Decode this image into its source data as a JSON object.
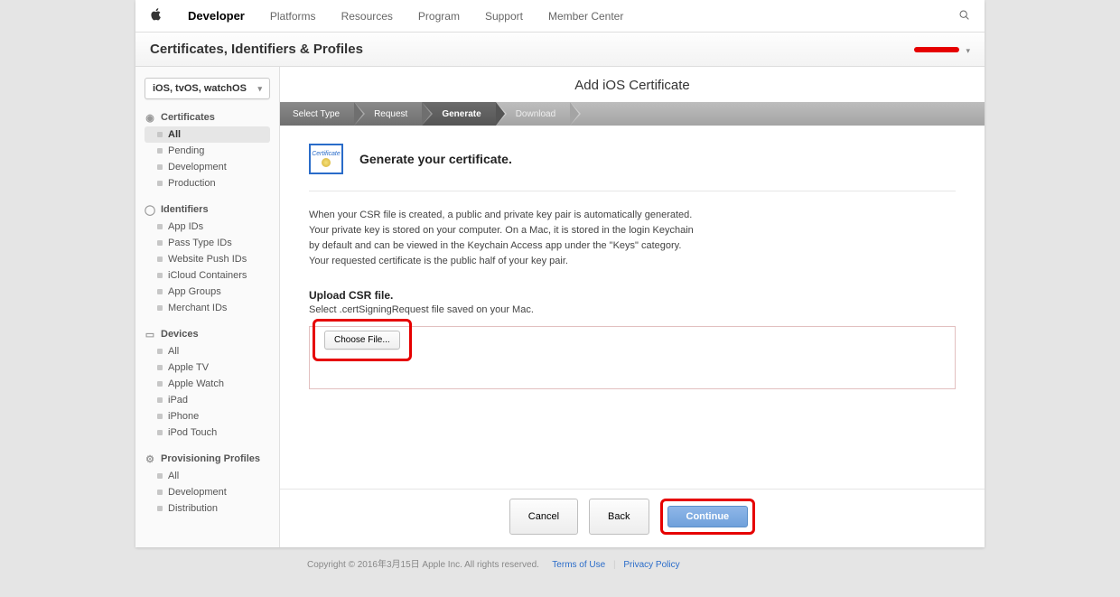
{
  "topnav": {
    "brand": "Developer",
    "links": [
      "Platforms",
      "Resources",
      "Program",
      "Support",
      "Member Center"
    ]
  },
  "subheader": {
    "title": "Certificates, Identifiers & Profiles"
  },
  "sidebar": {
    "platform_selector": "iOS, tvOS, watchOS",
    "groups": [
      {
        "label": "Certificates",
        "items": [
          "All",
          "Pending",
          "Development",
          "Production"
        ],
        "selected": 0
      },
      {
        "label": "Identifiers",
        "items": [
          "App IDs",
          "Pass Type IDs",
          "Website Push IDs",
          "iCloud Containers",
          "App Groups",
          "Merchant IDs"
        ],
        "selected": -1
      },
      {
        "label": "Devices",
        "items": [
          "All",
          "Apple TV",
          "Apple Watch",
          "iPad",
          "iPhone",
          "iPod Touch"
        ],
        "selected": -1
      },
      {
        "label": "Provisioning Profiles",
        "items": [
          "All",
          "Development",
          "Distribution"
        ],
        "selected": -1
      }
    ]
  },
  "main": {
    "page_title": "Add iOS Certificate",
    "wizard": {
      "steps": [
        "Select Type",
        "Request",
        "Generate",
        "Download"
      ],
      "active_index": 2
    },
    "intro_heading": "Generate your certificate.",
    "cert_icon_label": "Certificate",
    "description": "When your CSR file is created, a public and private key pair is automatically generated. Your private key is stored on your computer. On a Mac, it is stored in the login Keychain by default and can be viewed in the Keychain Access app under the \"Keys\" category. Your requested certificate is the public half of your key pair.",
    "upload": {
      "label": "Upload CSR file.",
      "subtext_prefix": "Select ",
      "subtext_ext": ".certSigningRequest",
      "subtext_suffix": " file saved on your Mac.",
      "choose_label": "Choose File..."
    },
    "buttons": {
      "cancel": "Cancel",
      "back": "Back",
      "continue": "Continue"
    }
  },
  "footer": {
    "copyright": "Copyright © 2016年3月15日 Apple Inc. All rights reserved.",
    "terms": "Terms of Use",
    "privacy": "Privacy Policy"
  }
}
